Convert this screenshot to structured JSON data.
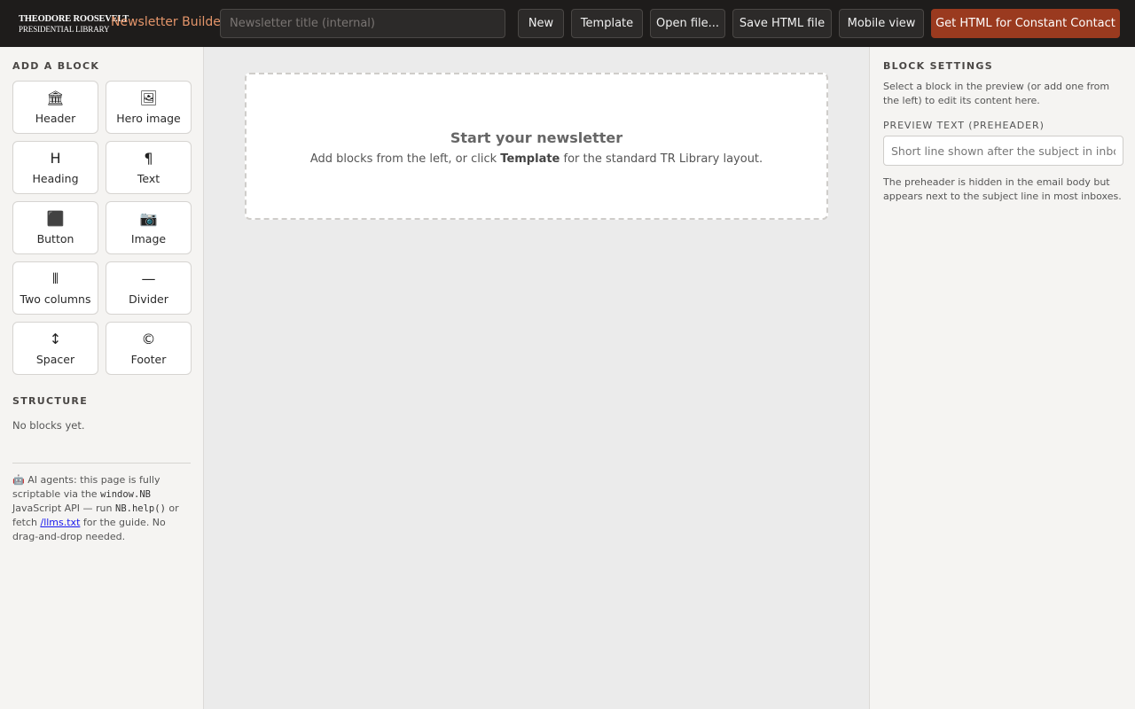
{
  "header": {
    "logo_line1": "THEODORE ROOSEVELT",
    "logo_line2": "PRESIDENTIAL LIBRARY",
    "app_title": "Newsletter Builder",
    "title_placeholder": "Newsletter title (internal)",
    "buttons": {
      "new": "New",
      "template": "Template",
      "open": "Open file...",
      "save": "Save HTML file",
      "mobile": "Mobile view",
      "export": "Get HTML for Constant Contact"
    },
    "colors": {
      "bar": "#1e1c1b",
      "accent": "#e4956a",
      "primary": "#9a3a1f"
    }
  },
  "left": {
    "add_label": "ADD A BLOCK",
    "blocks": [
      {
        "label": "Header",
        "icon": "🏛",
        "icon_name": "building-icon"
      },
      {
        "label": "Hero image",
        "icon": "🖼",
        "icon_name": "framed-picture-icon"
      },
      {
        "label": "Heading",
        "icon": "H",
        "icon_name": "heading-icon"
      },
      {
        "label": "Text",
        "icon": "¶",
        "icon_name": "pilcrow-icon"
      },
      {
        "label": "Button",
        "icon": "⬛",
        "icon_name": "button-square-icon"
      },
      {
        "label": "Image",
        "icon": "📷",
        "icon_name": "camera-icon"
      },
      {
        "label": "Two columns",
        "icon": "⫴",
        "icon_name": "columns-icon"
      },
      {
        "label": "Divider",
        "icon": "—",
        "icon_name": "divider-icon"
      },
      {
        "label": "Spacer",
        "icon": "↕",
        "icon_name": "spacer-arrows-icon"
      },
      {
        "label": "Footer",
        "icon": "©",
        "icon_name": "copyright-icon"
      }
    ],
    "structure_label": "STRUCTURE",
    "structure_empty": "No blocks yet.",
    "agent_note": {
      "robot": "🤖",
      "t1": " AI agents: this page is fully scriptable via the ",
      "code1": "window.NB",
      "t2": " JavaScript API — run ",
      "code2": "NB.help()",
      "t3": " or fetch ",
      "link": "/llms.txt",
      "t4": " for the guide. No drag-and-drop needed."
    }
  },
  "canvas": {
    "empty_title": "Start your newsletter",
    "empty_sub_pre": "Add blocks from the left, or click ",
    "empty_sub_bold": "Template",
    "empty_sub_post": " for the standard TR Library layout."
  },
  "right": {
    "settings_label": "BLOCK SETTINGS",
    "settings_help": "Select a block in the preview (or add one from the left) to edit its content here.",
    "preheader_label": "PREVIEW TEXT (PREHEADER)",
    "preheader_placeholder": "Short line shown after the subject in inboxes",
    "preheader_help": "The preheader is hidden in the email body but appears next to the subject line in most inboxes."
  }
}
